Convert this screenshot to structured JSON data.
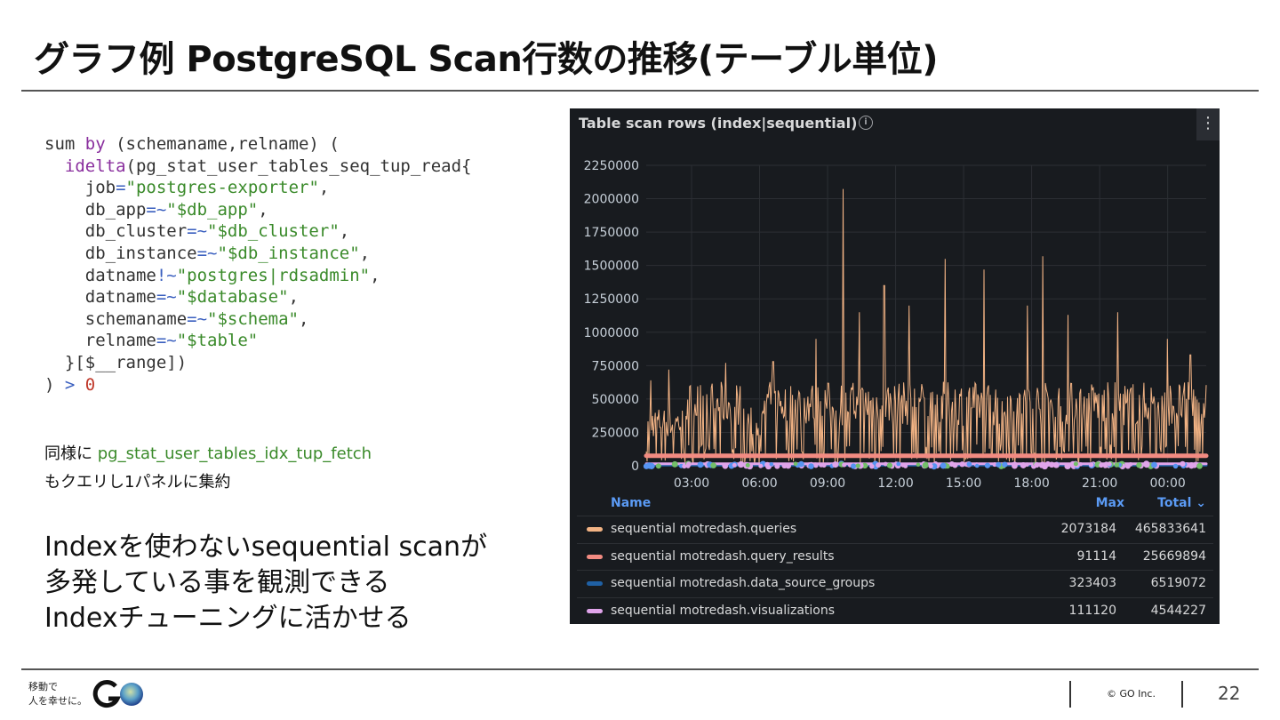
{
  "slide": {
    "title": "グラフ例 PostgreSQL Scan行数の推移(テーブル単位)",
    "code": {
      "l1_a": "sum ",
      "l1_kw": "by",
      "l1_b": " (schemaname,relname) (",
      "l2_kw": "idelta",
      "l2_b": "(pg_stat_user_tables_seq_tup_read{",
      "l3_a": "job",
      "l3_op": "=",
      "l3_s": "\"postgres-exporter\"",
      "l3_c": ",",
      "l4_a": "db_app",
      "l4_op": "=~",
      "l4_s": "\"$db_app\"",
      "l4_c": ",",
      "l5_a": "db_cluster",
      "l5_op": "=~",
      "l5_s": "\"$db_cluster\"",
      "l5_c": ",",
      "l6_a": "db_instance",
      "l6_op": "=~",
      "l6_s": "\"$db_instance\"",
      "l6_c": ",",
      "l7_a": "datname",
      "l7_op": "!~",
      "l7_s": "\"postgres|rdsadmin\"",
      "l7_c": ",",
      "l8_a": "datname",
      "l8_op": "=~",
      "l8_s": "\"$database\"",
      "l8_c": ",",
      "l9_a": "schemaname",
      "l9_op": "=~",
      "l9_s": "\"$schema\"",
      "l9_c": ",",
      "l10_a": "relname",
      "l10_op": "=~",
      "l10_s": "\"$table\"",
      "l11": "}[$__range])",
      "l12_a": ") ",
      "l12_op": ">",
      "l12_n": "0"
    },
    "note1_prefix": "同様に ",
    "note1_metric": "pg_stat_user_tables_idx_tup_fetch",
    "note2": "もクエリし1パネルに集約",
    "big_text": "Indexを使わないsequential scanが\n多発している事を観測できる\nIndexチューニングに活かせる",
    "footer": {
      "tagline": "移動で\n人を幸せに。",
      "logo": "GO",
      "copyright": "© GO Inc.",
      "page": "22"
    }
  },
  "panel": {
    "title": "Table scan rows (index|sequential)",
    "info_icon": "info-icon",
    "menu_icon": "kebab-menu-icon",
    "legend_headers": {
      "name": "Name",
      "max": "Max",
      "total": "Total ⌄"
    },
    "legend": [
      {
        "name": "sequential motredash.queries",
        "max": "2073184",
        "total": "465833641",
        "color": "#f2b384"
      },
      {
        "name": "sequential motredash.query_results",
        "max": "91114",
        "total": "25669894",
        "color": "#f28b82"
      },
      {
        "name": "sequential motredash.data_source_groups",
        "max": "323403",
        "total": "6519072",
        "color": "#1f60a4"
      },
      {
        "name": "sequential motredash.visualizations",
        "max": "111120",
        "total": "4544227",
        "color": "#e0a4ea"
      }
    ]
  },
  "chart_data": {
    "type": "line",
    "title": "Table scan rows (index|sequential)",
    "ylim": [
      0,
      2250000
    ],
    "yticks": [
      "0",
      "250000",
      "500000",
      "750000",
      "1000000",
      "1250000",
      "1500000",
      "1750000",
      "2000000",
      "2250000"
    ],
    "xticks": [
      "03:00",
      "06:00",
      "09:00",
      "12:00",
      "15:00",
      "18:00",
      "21:00",
      "00:00"
    ],
    "x_range_hours": [
      1.0,
      25.7
    ],
    "series": [
      {
        "name": "sequential motredash.queries",
        "color": "#f2b384",
        "approx_peaks": [
          [
            1.2,
            640000
          ],
          [
            2.0,
            720000
          ],
          [
            4.5,
            770000
          ],
          [
            6.6,
            780000
          ],
          [
            8.5,
            950000
          ],
          [
            9.7,
            2073184
          ],
          [
            10.4,
            1150000
          ],
          [
            11.5,
            1350000
          ],
          [
            12.6,
            1200000
          ],
          [
            14.2,
            1550000
          ],
          [
            15.9,
            1470000
          ],
          [
            17.8,
            1200000
          ],
          [
            18.5,
            1570000
          ],
          [
            19.6,
            1130000
          ],
          [
            21.8,
            1150000
          ],
          [
            24.0,
            950000
          ],
          [
            25.0,
            830000
          ]
        ],
        "baseline": 300000,
        "typical_peak": 600000
      },
      {
        "name": "sequential motredash.query_results",
        "color": "#f28b82",
        "level": 75000
      },
      {
        "name": "sequential motredash.data_source_groups",
        "color": "#1f60a4",
        "level": 5000
      },
      {
        "name": "sequential motredash.visualizations",
        "color": "#e0a4ea",
        "level": 15000
      }
    ]
  }
}
